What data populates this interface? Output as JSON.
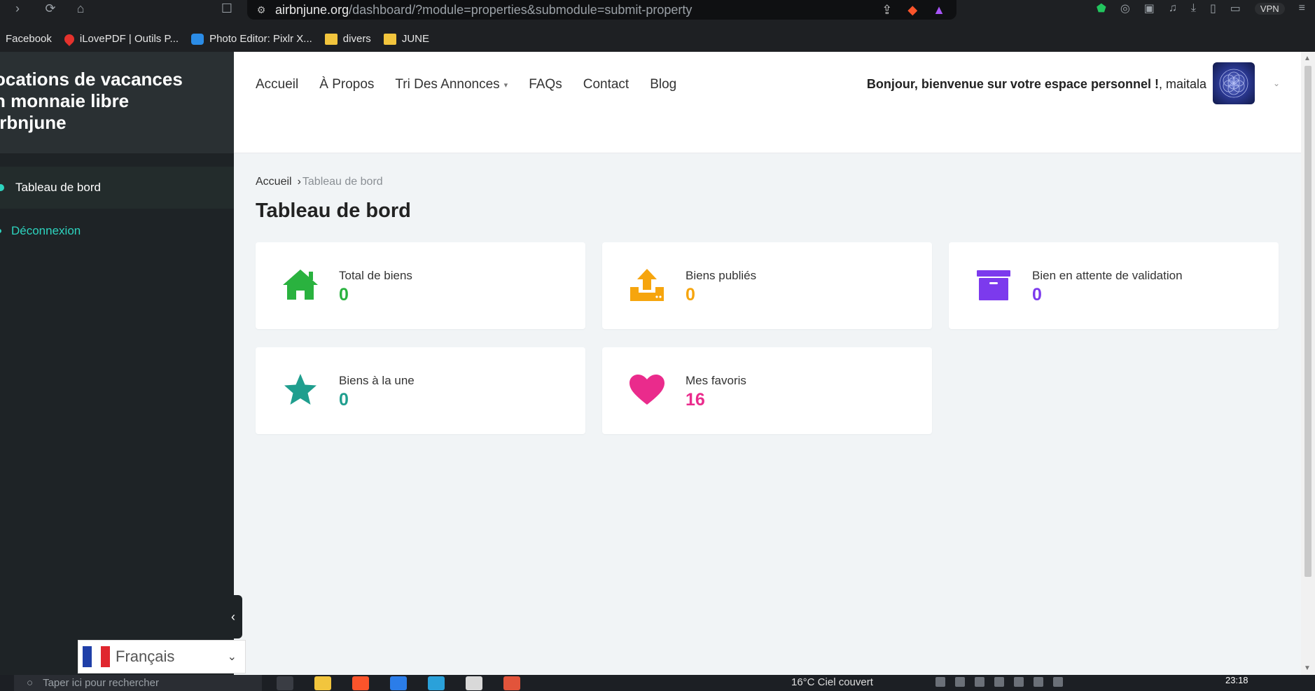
{
  "browser": {
    "url_domain": "airbnjune.org",
    "url_path": "/dashboard/?module=properties&submodule=submit-property",
    "vpn_label": "VPN"
  },
  "bookmarks": [
    {
      "label": "Facebook",
      "icon": "facebook-icon"
    },
    {
      "label": "iLovePDF | Outils P...",
      "icon": "ilovepdf-icon"
    },
    {
      "label": "Photo Editor: Pixlr X...",
      "icon": "pixlr-icon"
    },
    {
      "label": "divers",
      "icon": "folder-icon"
    },
    {
      "label": "JUNE",
      "icon": "folder-icon"
    }
  ],
  "sidebar": {
    "brand_lines": [
      "ocations de vacances",
      "n monnaie libre",
      "irbnjune"
    ],
    "items": [
      {
        "label": "Tableau de bord",
        "active": true
      },
      {
        "label": "Déconnexion",
        "active": false
      }
    ]
  },
  "header": {
    "nav": [
      {
        "label": "Accueil"
      },
      {
        "label": "À Propos"
      },
      {
        "label": "Tri Des Annonces",
        "dropdown": true
      },
      {
        "label": "FAQs"
      },
      {
        "label": "Contact"
      },
      {
        "label": "Blog"
      }
    ],
    "greeting_bold": "Bonjour, bienvenue sur votre espace personnel !",
    "greeting_user": ", maitala"
  },
  "main": {
    "breadcrumb": {
      "home": "Accueil",
      "sep": "›",
      "current": "Tableau de bord"
    },
    "title": "Tableau de bord",
    "cards": [
      {
        "label": "Total de biens",
        "value": "0",
        "icon": "home-icon",
        "color": "#2ab23f"
      },
      {
        "label": "Biens publiés",
        "value": "0",
        "icon": "upload-icon",
        "color": "#f6a50e"
      },
      {
        "label": "Bien en attente de validation",
        "value": "0",
        "icon": "archive-icon",
        "color": "#7c3aed"
      },
      {
        "label": "Biens à la une",
        "value": "0",
        "icon": "star-icon",
        "color": "#1f9e8e"
      },
      {
        "label": "Mes favoris",
        "value": "16",
        "icon": "heart-icon",
        "color": "#ea2b8c"
      }
    ]
  },
  "language": {
    "selected": "Français"
  },
  "taskbar": {
    "search_placeholder": "Taper ici pour rechercher",
    "weather": "16°C  Ciel couvert",
    "time": "23:18"
  }
}
